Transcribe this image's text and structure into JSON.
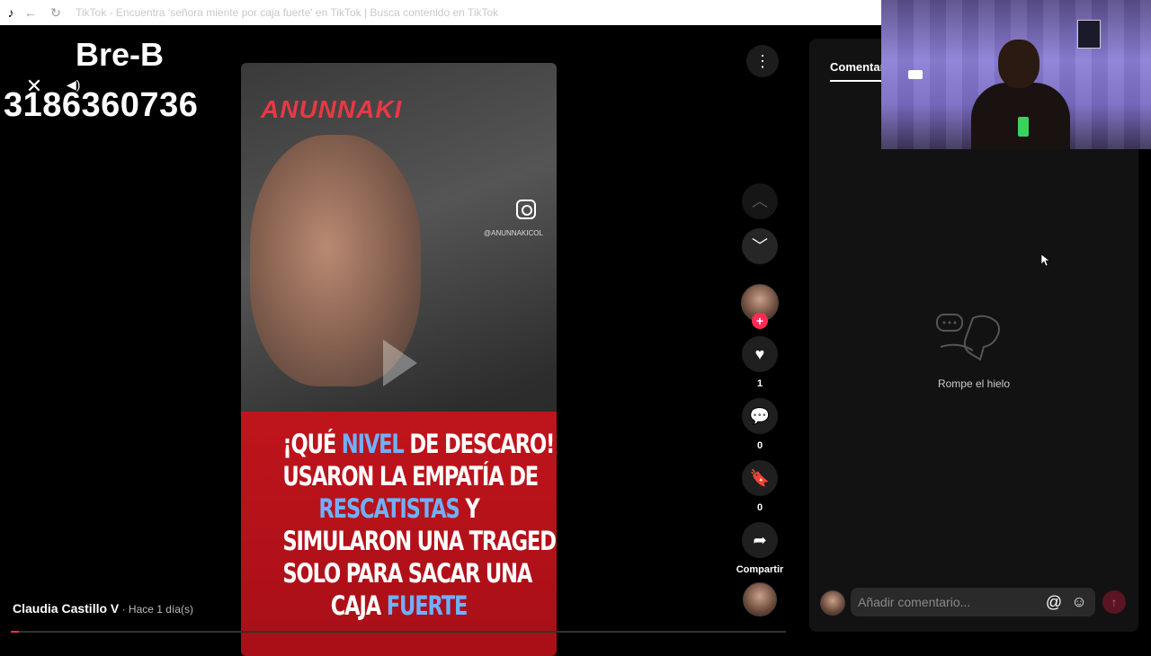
{
  "browser": {
    "title": "TikTok - Encuentra 'señora miente por caja fuerte' en TikTok | Busca contenido en TikTok",
    "back_icon": "←",
    "reload_icon": "↻"
  },
  "overlay": {
    "name": "Bre-B",
    "number": "3186360736"
  },
  "video": {
    "brand": "ANUNNAKI",
    "ig_handle": "@ANUNNAKICOL",
    "banner_lines": [
      {
        "parts": [
          {
            "t": "¡QUÉ "
          },
          {
            "t": "NIVEL",
            "hl": true
          },
          {
            "t": " DE DESCARO!"
          }
        ]
      },
      {
        "parts": [
          {
            "t": "USARON LA EMPATÍA DE"
          }
        ]
      },
      {
        "parts": [
          {
            "t": "RESCATISTAS",
            "hl": true
          },
          {
            "t": " Y"
          }
        ]
      },
      {
        "parts": [
          {
            "t": "SIMULARON UNA TRAGEDIA"
          }
        ]
      },
      {
        "parts": [
          {
            "t": "SOLO PARA SACAR UNA"
          }
        ]
      },
      {
        "parts": [
          {
            "t": "CAJA "
          },
          {
            "t": "FUERTE",
            "hl": true
          }
        ]
      }
    ],
    "progress": 0.01
  },
  "actions": {
    "likes": "1",
    "comments": "0",
    "saves": "0",
    "share_label": "Compartir"
  },
  "author": {
    "name": "Claudia Castillo V",
    "time": " · Hace 1 día(s)"
  },
  "comments_panel": {
    "tab_label": "Comentar",
    "empty_text": "Rompe el hielo",
    "input_placeholder": "Añadir comentario...",
    "at_icon": "@",
    "emoji_icon": "☺",
    "send_icon": "↑"
  },
  "colors": {
    "accent": "#fe2c55",
    "highlight": "#6fb0ff",
    "banner": "#c0141c"
  }
}
